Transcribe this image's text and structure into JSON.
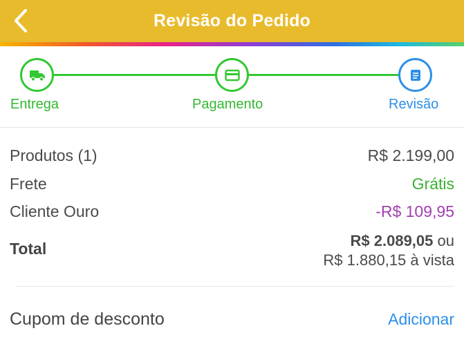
{
  "header": {
    "title": "Revisão do Pedido"
  },
  "steps": [
    {
      "label": "Entrega",
      "icon": "truck-icon"
    },
    {
      "label": "Pagamento",
      "icon": "credit-card-icon"
    },
    {
      "label": "Revisão",
      "icon": "receipt-icon"
    }
  ],
  "summary": {
    "products_label": "Produtos (1)",
    "products_value": "R$ 2.199,00",
    "shipping_label": "Frete",
    "shipping_value": "Grátis",
    "club_label": "Cliente Ouro",
    "club_value": "-R$ 109,95",
    "total_label": "Total",
    "total_value": "R$ 2.089,05",
    "total_or": "ou",
    "total_cash": "R$ 1.880,15 à vista"
  },
  "coupon": {
    "label": "Cupom de desconto",
    "action": "Adicionar"
  },
  "colors": {
    "header": "#e8bb2c",
    "step_done": "#32c832",
    "step_active": "#2b8fe8",
    "discount": "#a23fb0"
  }
}
